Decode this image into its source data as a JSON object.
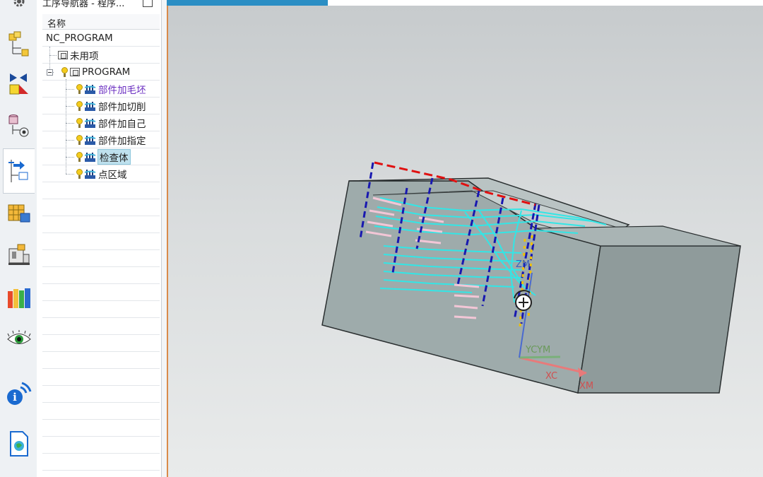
{
  "navigator": {
    "title": "工序导航器 - 程序...",
    "column_header": "名称",
    "root": "NC_PROGRAM",
    "unused": "未用项",
    "program": "PROGRAM",
    "operations": [
      {
        "label": "部件加毛坯"
      },
      {
        "label": "部件加切削"
      },
      {
        "label": "部件加自己"
      },
      {
        "label": "部件加指定"
      },
      {
        "label": "检查体"
      },
      {
        "label": "点区域"
      }
    ]
  },
  "resource_bar": {
    "icons": [
      "machine-tool-navigator-icon",
      "geometry-navigator-icon",
      "part-navigator-icon",
      "operation-navigator-icon",
      "library-icon",
      "machine-icon",
      "reuse-library-icon",
      "visualization-icon",
      "info-icon",
      "web-page-icon"
    ]
  },
  "viewport": {
    "axis_labels": {
      "zm": "ZM",
      "ycym": "YCYM",
      "xc": "XC",
      "xm": "XM"
    },
    "colors": {
      "toolpath": "#32e6e6",
      "rapid": "#e01010",
      "engage": "#1a1ab8",
      "retract": "#f0c000",
      "part": "#aebaba"
    }
  }
}
